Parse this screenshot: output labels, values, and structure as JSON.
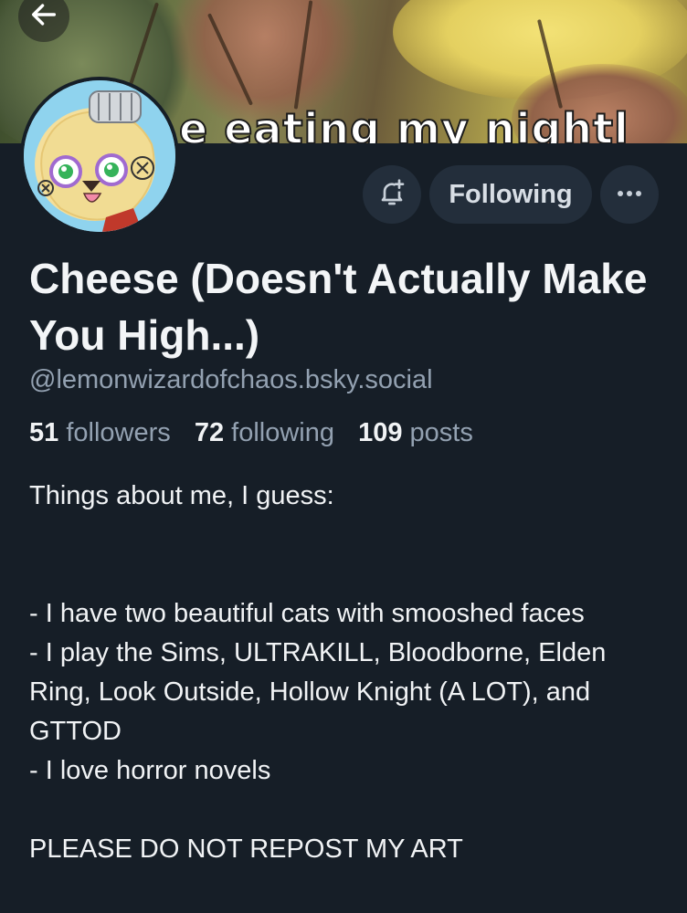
{
  "banner": {
    "caption": "e eating my nightl"
  },
  "profile": {
    "display_name": "Cheese (Doesn't Actually Make You High...)",
    "handle": "@lemonwizardofchaos.bsky.social"
  },
  "actions": {
    "following_label": "Following"
  },
  "stats": {
    "followers_count": "51",
    "followers_label": "followers",
    "following_count": "72",
    "following_label": "following",
    "posts_count": "109",
    "posts_label": "posts"
  },
  "bio": {
    "lines": [
      "Things about me, I guess:",
      "",
      "",
      "- I have two beautiful cats with smooshed faces",
      "- I play the Sims, ULTRAKILL, Bloodborne, Elden Ring, Look Outside, Hollow Knight (A LOT), and GTTOD",
      "- I love horror novels",
      "",
      "PLEASE DO NOT REPOST MY ART"
    ]
  },
  "colors": {
    "background": "#161e27",
    "button_bg": "#232e3b",
    "muted_text": "#93a1b1",
    "primary_text": "#f1f3f5"
  },
  "icons": {
    "back": "arrow-left-icon",
    "notify": "bell-plus-icon",
    "more": "ellipsis-icon"
  }
}
